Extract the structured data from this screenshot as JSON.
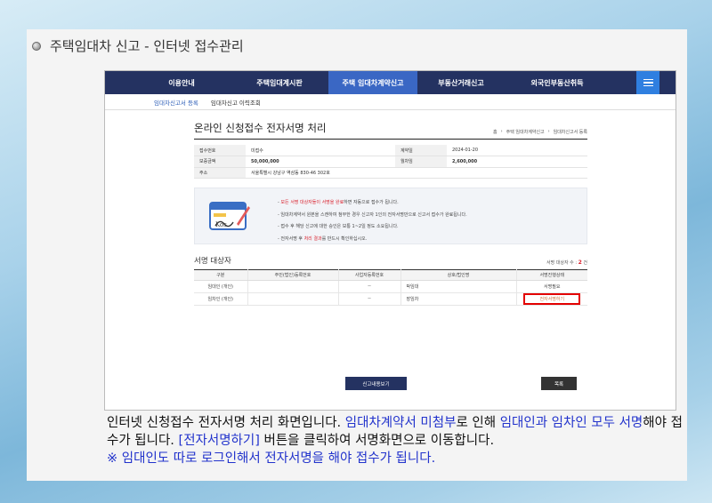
{
  "slide": {
    "title": "주택임대차 신고 - 인터넷 접수관리"
  },
  "nav": {
    "items": [
      "이용안내",
      "주택임대계시판",
      "주택 임대차계약신고",
      "부동산거래신고",
      "외국인부동산취득"
    ],
    "active_index": 2
  },
  "subnav": {
    "items": [
      "임대차신고서 등록",
      "임대차신고 이력조회"
    ]
  },
  "page": {
    "title": "온라인 신청접수 전자서명 처리",
    "breadcrumb": [
      "홈",
      "주택 임대차계약신고",
      "임대차신고서 등록"
    ]
  },
  "info": {
    "rows": [
      {
        "k1": "접수번호",
        "v1": "미접수",
        "k2": "계약일",
        "v2": "2024-01-20"
      },
      {
        "k1": "보증금액",
        "v1": "50,000,000",
        "k2": "월차임",
        "v2": "2,600,000"
      },
      {
        "k1": "주소",
        "v1": "서울특별시 강남구 역삼동 830-46 302호",
        "k2": "",
        "v2": ""
      }
    ]
  },
  "notice": {
    "line1_pre": "- ",
    "line1_red": "모든 서명 대상자들이 서명을 완료",
    "line1_post": "하면 자동으로 접수가 됩니다.",
    "line2": "- 임대차계약서 원본을 스캔하여 첨부한 경우 신고자 1인의 전자서명만으로 신고서 접수가 완료됩니다.",
    "line3": "- 접수 후 해당 신고에 대한 승인은 보통 1~2일 정도 소요됩니다.",
    "line4_pre": "- 전자서명 후 ",
    "line4_red": "처리 결과",
    "line4_post": "를 반드시 확인하십시오."
  },
  "signers": {
    "title": "서명 대상자",
    "count_label": "서명 대상자 수",
    "count": "2",
    "count_unit": "건",
    "headers": [
      "구분",
      "주민(법인)등록번호",
      "사업자등록번호",
      "상호/법인명",
      "서명진행상태"
    ],
    "rows": [
      {
        "type": "임대인 (개인)",
        "rrn": "",
        "biz": "--",
        "name": "박임대",
        "status": "서명필요"
      },
      {
        "type": "임차인 (개인)",
        "rrn": "",
        "biz": "--",
        "name": "장임차",
        "status": "전자서명하기"
      }
    ]
  },
  "buttons": {
    "view": "신고내용보기",
    "list": "목록"
  },
  "caption": {
    "t1": "인터넷 신청접수 전자서명 처리 화면입니다. ",
    "b1": "임대차계약서 미첨부",
    "t2": "로 인해 ",
    "b2": "임대인과 임차인 모두 서명",
    "t3": "해야 접수가 됩니다. ",
    "b3": "[전자서명하기]",
    "t4": " 버튼을 클릭하여 서명화면으로 이동합니다.",
    "note": "※ 임대인도 따로 로그인해서 전자서명을 해야 접수가 됩니다."
  }
}
